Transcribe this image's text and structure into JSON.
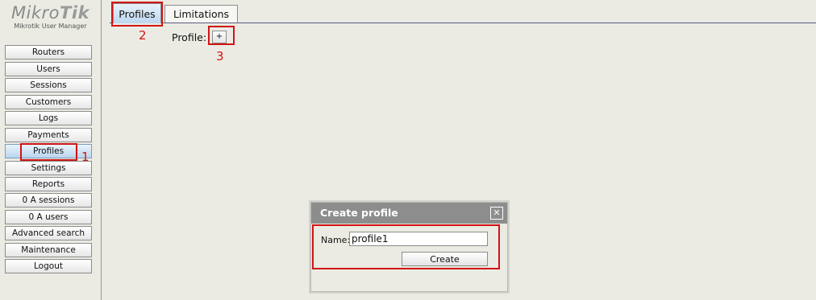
{
  "logo": {
    "brand_light": "Mikro",
    "brand_bold": "Tik",
    "subtitle": "Mikrotik User Manager"
  },
  "sidebar": {
    "items": [
      {
        "label": "Routers"
      },
      {
        "label": "Users"
      },
      {
        "label": "Sessions"
      },
      {
        "label": "Customers"
      },
      {
        "label": "Logs"
      },
      {
        "label": "Payments"
      },
      {
        "label": "Profiles",
        "active": true
      },
      {
        "label": "Settings"
      },
      {
        "label": "Reports"
      },
      {
        "label": "0 A sessions"
      },
      {
        "label": "0 A users"
      },
      {
        "label": "Advanced search"
      },
      {
        "label": "Maintenance"
      },
      {
        "label": "Logout"
      }
    ]
  },
  "tabs": [
    {
      "label": "Profiles",
      "active": true
    },
    {
      "label": "Limitations",
      "active": false
    }
  ],
  "profile_row": {
    "label": "Profile:",
    "add_button": "+"
  },
  "dialog": {
    "title": "Create profile",
    "close_icon": "close-icon",
    "name_label": "Name:",
    "name_value": "profile1",
    "create_button": "Create"
  },
  "annotations": {
    "step1": "1",
    "step2": "2",
    "step3": "3",
    "color": "#d11414"
  },
  "colors": {
    "active_button": "#b9d6ee",
    "dialog_title_bg": "#8d8d8d",
    "background": "#ebebe4"
  }
}
